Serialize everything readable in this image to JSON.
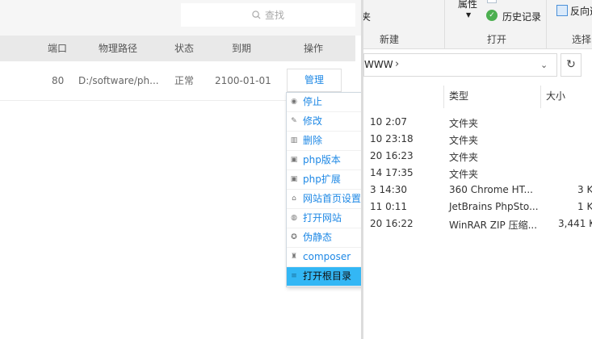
{
  "search": {
    "placeholder": "查找"
  },
  "table": {
    "headers": {
      "port": "端口",
      "path": "物理路径",
      "status": "状态",
      "expire": "到期",
      "action": "操作"
    },
    "row": {
      "port": "80",
      "path": "D:/software/ph...",
      "status": "正常",
      "expire": "2100-01-01",
      "action": "管理"
    }
  },
  "menu": {
    "items": [
      {
        "label": "停止",
        "icon": "stop-icon"
      },
      {
        "label": "修改",
        "icon": "edit-icon"
      },
      {
        "label": "删除",
        "icon": "delete-icon"
      },
      {
        "label": "php版本",
        "icon": "php-version-icon",
        "submenu": true
      },
      {
        "label": "php扩展",
        "icon": "php-extension-icon",
        "submenu": true
      },
      {
        "label": "网站首页设置",
        "icon": "home-icon"
      },
      {
        "label": "打开网站",
        "icon": "globe-icon"
      },
      {
        "label": "伪静态",
        "icon": "rewrite-icon"
      },
      {
        "label": "composer",
        "icon": "composer-icon"
      },
      {
        "label": "打开根目录",
        "icon": "folder-icon",
        "active": true
      }
    ]
  },
  "explorer": {
    "ribbon": {
      "top_fragment": "夹",
      "properties": "属性",
      "history": "历史记录",
      "reverse": "反向选",
      "group_new": "新建",
      "group_open": "打开",
      "group_select": "选择"
    },
    "address": {
      "path": "WWW",
      "separator": "›"
    },
    "columns": {
      "type": "类型",
      "size": "大小"
    },
    "files": [
      {
        "date": "10 2:07",
        "type": "文件夹",
        "size": ""
      },
      {
        "date": "10 23:18",
        "type": "文件夹",
        "size": ""
      },
      {
        "date": "20 16:23",
        "type": "文件夹",
        "size": ""
      },
      {
        "date": "14 17:35",
        "type": "文件夹",
        "size": ""
      },
      {
        "date": "3 14:30",
        "type": "360 Chrome HT...",
        "size": "3 K"
      },
      {
        "date": "11 0:11",
        "type": "JetBrains PhpSto...",
        "size": "1 K"
      },
      {
        "date": "20 16:22",
        "type": "WinRAR ZIP 压缩...",
        "size": "3,441 K"
      }
    ]
  },
  "colors": {
    "accent": "#1e88e5",
    "active_bg": "#33b7f5",
    "header_bg": "#e9e9e9"
  }
}
